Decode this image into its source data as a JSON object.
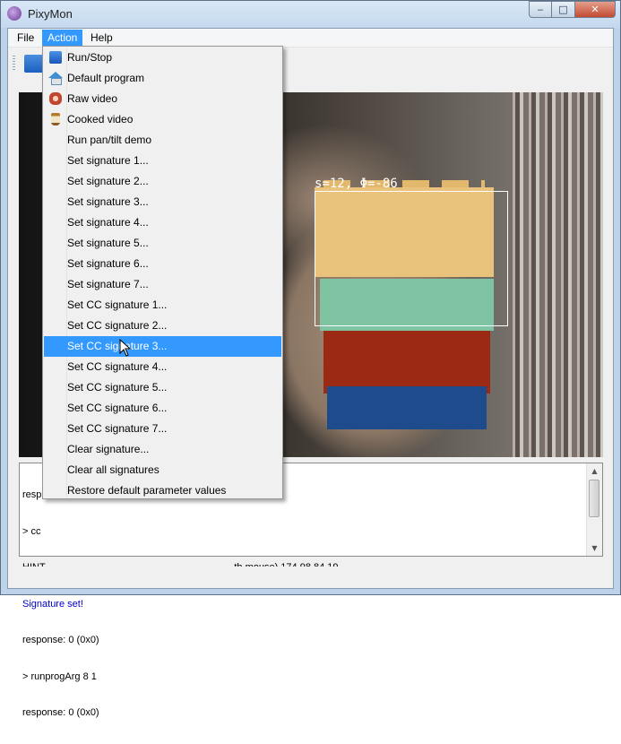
{
  "window": {
    "title": "PixyMon",
    "controls": {
      "minimize": "‒",
      "maximize": "□",
      "close": "✕"
    }
  },
  "menubar": {
    "items": [
      "File",
      "Action",
      "Help"
    ],
    "active": "Action"
  },
  "action_menu": {
    "highlighted": "Set CC signature 3...",
    "items": [
      {
        "label": "Run/Stop",
        "icon": "run-stop-icon"
      },
      {
        "label": "Default program",
        "icon": "home-icon"
      },
      {
        "label": "Raw video",
        "icon": "raw-meat-icon"
      },
      {
        "label": "Cooked video",
        "icon": "cooked-food-icon"
      },
      {
        "label": "Run pan/tilt demo"
      },
      {
        "label": "Set signature 1..."
      },
      {
        "label": "Set signature 2..."
      },
      {
        "label": "Set signature 3..."
      },
      {
        "label": "Set signature 4..."
      },
      {
        "label": "Set signature 5..."
      },
      {
        "label": "Set signature 6..."
      },
      {
        "label": "Set signature 7..."
      },
      {
        "label": "Set CC signature 1..."
      },
      {
        "label": "Set CC signature 2..."
      },
      {
        "label": "Set CC signature 3..."
      },
      {
        "label": "Set CC signature 4..."
      },
      {
        "label": "Set CC signature 5..."
      },
      {
        "label": "Set CC signature 6..."
      },
      {
        "label": "Set CC signature 7..."
      },
      {
        "label": "Clear signature..."
      },
      {
        "label": "Clear all signatures"
      },
      {
        "label": "Restore default parameter values"
      }
    ]
  },
  "video": {
    "detection_label": "s=12, Φ=-86"
  },
  "console": {
    "lines": [
      {
        "text": "resp",
        "color": "#000000"
      },
      {
        "text": "> cc",
        "color": "#000000"
      },
      {
        "text": "HINT                                                                     th mouse) 174 98 84 19",
        "color": "#000000"
      },
      {
        "text": "Signature set!",
        "color": "#0000c8"
      },
      {
        "text": "response: 0 (0x0)",
        "color": "#000000"
      },
      {
        "text": "> runprogArg 8 1",
        "color": "#000000"
      },
      {
        "text": "response: 0 (0x0)",
        "color": "#000000"
      }
    ]
  },
  "colors": {
    "menu_highlight": "#3399ff",
    "title_bar": "#c4d8ee",
    "close_button": "#c24a32"
  }
}
